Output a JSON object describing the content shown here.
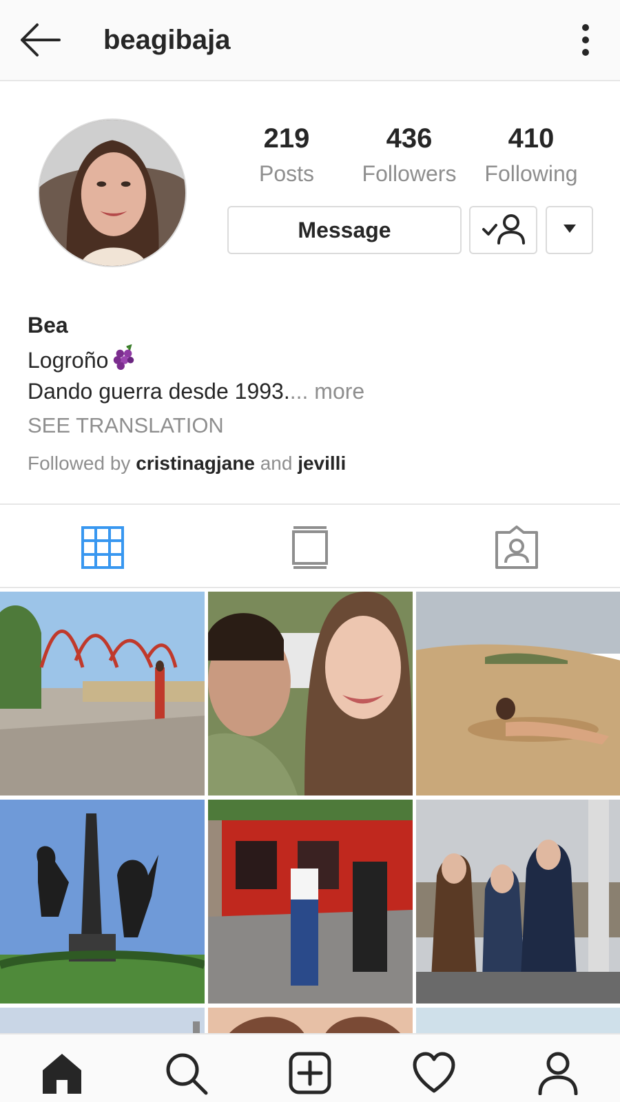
{
  "header": {
    "username": "beagibaja",
    "back_icon": "arrow-left-icon",
    "more_icon": "more-vertical-icon"
  },
  "stats": [
    {
      "value": "219",
      "label": "Posts"
    },
    {
      "value": "436",
      "label": "Followers"
    },
    {
      "value": "410",
      "label": "Following"
    }
  ],
  "actions": {
    "message_label": "Message",
    "following_icon": "person-check-icon",
    "dropdown_icon": "caret-down-icon"
  },
  "bio": {
    "name": "Bea",
    "location": "Logroño",
    "location_emoji": "grapes-emoji",
    "text": "Dando guerra desde 1993.",
    "more": "... more",
    "see_translation": "SEE TRANSLATION",
    "followed_by_prefix": "Followed by",
    "followed_by_user1": "cristinagjane",
    "followed_by_and": "and",
    "followed_by_user2": "jevilli"
  },
  "tabs": [
    {
      "icon": "grid-icon",
      "active": true
    },
    {
      "icon": "feed-icon",
      "active": false
    },
    {
      "icon": "tagged-icon",
      "active": false
    }
  ],
  "bottom_nav": [
    "home-icon",
    "search-icon",
    "add-post-icon",
    "heart-icon",
    "profile-icon"
  ],
  "colors": {
    "accent_blue": "#3897f0",
    "text_primary": "#262626",
    "text_secondary": "#8e8e8e",
    "border": "#dbdbdb"
  }
}
